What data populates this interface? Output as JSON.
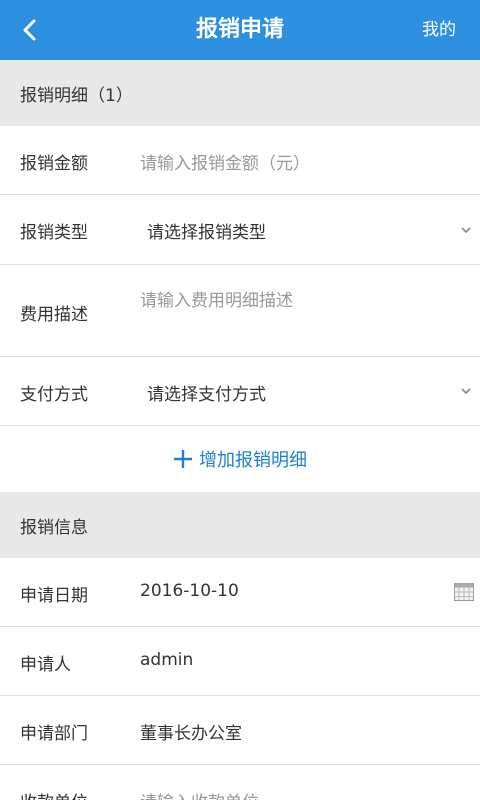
{
  "header": {
    "title": "报销申请",
    "mine_label": "我的"
  },
  "detail_section": {
    "title": "报销明细（1）",
    "amount": {
      "label": "报销金额",
      "placeholder": "请输入报销金额（元）"
    },
    "type": {
      "label": "报销类型",
      "value": "请选择报销类型"
    },
    "description": {
      "label": "费用描述",
      "placeholder": "请输入费用明细描述"
    },
    "payment": {
      "label": "支付方式",
      "value": "请选择支付方式"
    },
    "add_label": "增加报销明细"
  },
  "info_section": {
    "title": "报销信息",
    "date": {
      "label": "申请日期",
      "value": "2016-10-10"
    },
    "applicant": {
      "label": "申请人",
      "value": "admin"
    },
    "department": {
      "label": "申请部门",
      "value": "董事长办公室"
    },
    "payee": {
      "label": "收款单位",
      "placeholder": "请输入收款单位"
    }
  },
  "colors": {
    "header_bg": "#2d8fe0",
    "section_bg": "#e8e8e8",
    "accent": "#1f7fd0",
    "placeholder": "#999999"
  }
}
